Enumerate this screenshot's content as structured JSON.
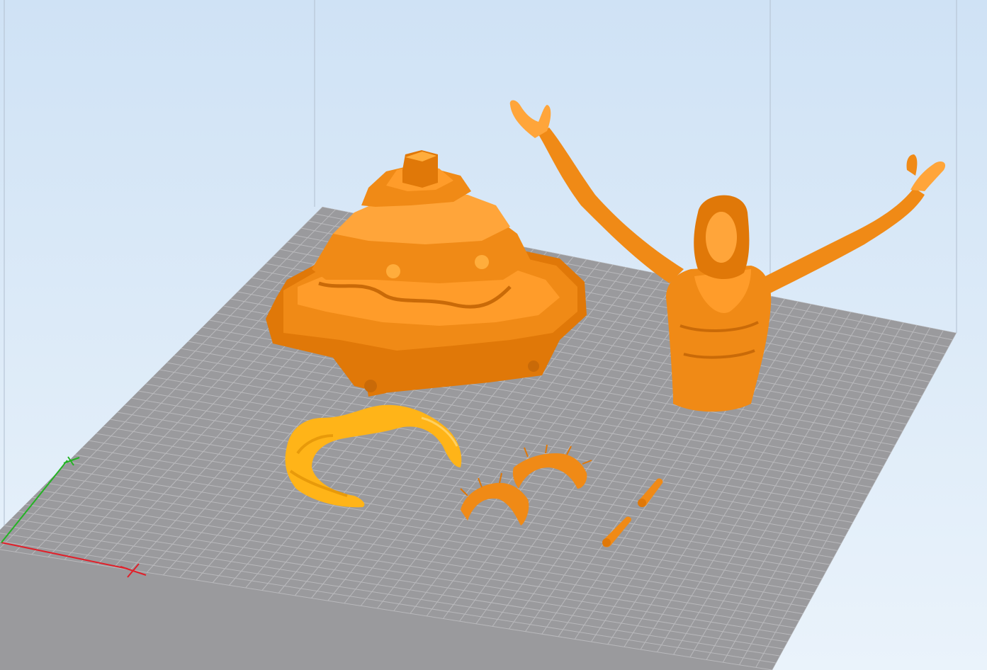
{
  "app": {
    "view": "3d-build-plate-viewport"
  },
  "colors": {
    "background_top": "#cfe2f5",
    "background_bottom": "#eaf3fb",
    "plate": "#9a9a9d",
    "grid_line": "#b9b9bc",
    "model": "#f08a16",
    "model_shadow": "#c96a08",
    "model_highlight": "#ffad3c",
    "selected_model": "#ffb418",
    "axis_x": "#e0202a",
    "axis_y": "#24b324",
    "frame": "#b8c6d6"
  },
  "models": [
    {
      "name": "pedestal-base",
      "state": "unselected"
    },
    {
      "name": "torso-figure",
      "state": "unselected"
    },
    {
      "name": "crown-ornament",
      "state": "selected"
    },
    {
      "name": "thorn-crown-halves",
      "state": "unselected"
    },
    {
      "name": "pin-part-1",
      "state": "unselected"
    },
    {
      "name": "pin-part-2",
      "state": "unselected"
    }
  ],
  "axes": {
    "icons": [
      "x-axis-icon",
      "y-axis-icon",
      "origin-cross-icon"
    ]
  }
}
